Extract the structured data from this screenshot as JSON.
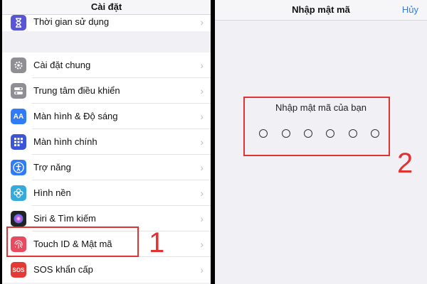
{
  "left_panel": {
    "title": "Cài đặt",
    "top_item": {
      "label": "Thời gian sử dụng",
      "icon": "hourglass-icon",
      "color": "#5856d6"
    },
    "items": [
      {
        "label": "Cài đặt chung",
        "icon": "gear-icon",
        "color": "#8e8e93"
      },
      {
        "label": "Trung tâm điều khiển",
        "icon": "toggles-icon",
        "color": "#8e8e93"
      },
      {
        "label": "Màn hình & Độ sáng",
        "icon": "text-size-icon",
        "color": "#2f7cf6"
      },
      {
        "label": "Màn hình chính",
        "icon": "grid-icon",
        "color": "#3a55d8"
      },
      {
        "label": "Trợ năng",
        "icon": "accessibility-icon",
        "color": "#2f7cf6"
      },
      {
        "label": "Hình nền",
        "icon": "flower-icon",
        "color": "#35aadc"
      },
      {
        "label": "Siri & Tìm kiếm",
        "icon": "siri-icon",
        "color": "#222222"
      },
      {
        "label": "Touch ID & Mật mã",
        "icon": "fingerprint-icon",
        "color": "#e84a5f"
      },
      {
        "label": "SOS khẩn cấp",
        "icon": "sos-icon",
        "color": "#e53935"
      }
    ],
    "highlight_number": "1"
  },
  "right_panel": {
    "title": "Nhập mật mã",
    "cancel_label": "Hủy",
    "prompt": "Nhập mật mã của bạn",
    "passcode_digits_entered": 0,
    "passcode_length": 6,
    "highlight_number": "2"
  },
  "accent_color": "#e23333"
}
